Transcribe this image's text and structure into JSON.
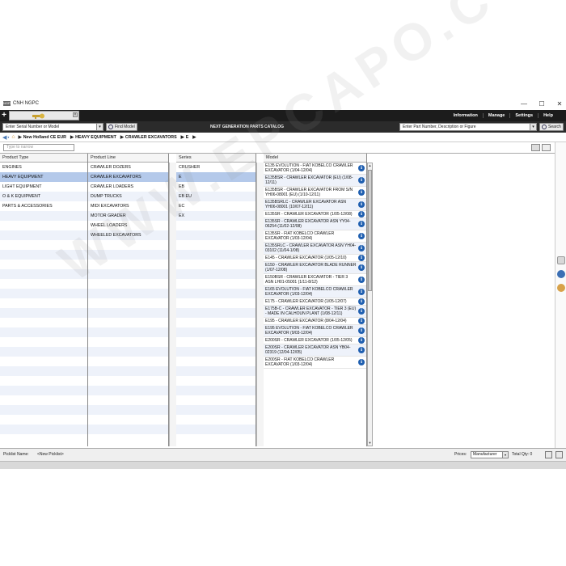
{
  "window": {
    "app_icon_text": "NGPC",
    "title": "CNH NGPC",
    "minimize": "—",
    "maximize": "☐",
    "close": "✕"
  },
  "menubar": {
    "new_tab": "+",
    "tab_close": "×",
    "items": [
      "Information",
      "Manage",
      "Settings",
      "Help"
    ]
  },
  "search": {
    "serial_placeholder": "Enter Serial Number or Model",
    "find_model": "Find Model",
    "catalog_title": "NEXT GENERATION PARTS CATALOG",
    "part_placeholder": "Enter Part Number, Description or Figure",
    "search_label": "Search"
  },
  "breadcrumb": [
    "New Holland CE EUR",
    "HEAVY EQUIPMENT",
    "CRAWLER EXCAVATORS",
    "E"
  ],
  "filter": {
    "placeholder": "Type to narrow"
  },
  "columns": {
    "product_type": {
      "header": "Product Type",
      "items": [
        "ENGINES",
        "HEAVY EQUIPMENT",
        "LIGHT EQUIPMENT",
        "O & K EQUIPMENT",
        "PARTS & ACCESSORIES"
      ],
      "selected": 1
    },
    "product_line": {
      "header": "Product Line",
      "items": [
        "CRAWLER DOZERS",
        "CRAWLER EXCAVATORS",
        "CRAWLER LOADERS",
        "DUMP TRUCKS",
        "MIDI EXCAVATORS",
        "MOTOR GRADER",
        "WHEEL LOADERS",
        "WHEELED EXCAVATORS"
      ],
      "selected": 1
    },
    "series": {
      "header": "Series",
      "items": [
        "CRUSHER",
        "E",
        "EB",
        "EB EU",
        "EC",
        "EX"
      ],
      "selected": 1
    },
    "model": {
      "header": "Model",
      "items": [
        "E135 EVOLUTION - FIAT KOBELCO CRAWLER EXCAVATOR (1/04-12/04)",
        "E135BSR - CRAWLER EXCAVATOR (EU) (1/08-12/11)",
        "E135BSR - CRAWLER EXCAVATOR FROM S/N YH06-08001 (EU) (1/10-12/11)",
        "E135BSRLC - CRAWLER EXCAVATOR ASN YH06-08001 (10/07-12/11)",
        "E135SR - CRAWLER EXCAVATOR (1/05-12/08)",
        "E135SR - CRAWLER EXCAVATOR ASN YY04-06254 (11/02-12/08)",
        "E135SR - FIAT KOBELCO CRAWLER EXCAVATOR (1/03-12/04)",
        "E135SRLC - CRAWLER EXCAVATOR ASN YH04-03102 (11/04-1/08)",
        "E145 - CRAWLER EXCAVATOR (1/05-12/10)",
        "E150 - CRAWLER EXCAVATOR BLADE RUNNER (1/07-12/08)",
        "E150BSR - CRAWLER EXCAVATOR - TIER 3 ASN LH01-05001 (1/11-8/12)",
        "E165 EVOLUTION - FIAT KOBELCO CRAWLER EXCAVATOR (1/03-12/04)",
        "E175 - CRAWLER EXCAVATOR (1/05-12/07)",
        "E175B-C - CRAWLER EXCAVATOR - TIER 3 (EU) - MADE IN CALHOUN PLANT (1/08-12/11)",
        "E195 - CRAWLER EXCAVATOR (8/04-12/04)",
        "E195 EVOLUTION - FIAT KOBELCO CRAWLER EXCAVATOR (9/03-12/04)",
        "E200SR - CRAWLER EXCAVATOR (1/05-12/05)",
        "E200SR - CRAWLER EXCAVATOR ASN YB04-02319 (12/04-12/05)",
        "E200SR - FIAT KOBELCO CRAWLER EXCAVATOR (1/03-12/04)"
      ],
      "info_icon": "i"
    }
  },
  "status": {
    "picklist_label": "Picklist Name:",
    "picklist_value": "<New Picklist>",
    "prices_label": "Prices:",
    "prices_value": "Manufacturer",
    "total_qty": "Total Qty: 0"
  },
  "watermark": "WWW.EPCAPO.COM",
  "colors": {
    "menubar": "#1c1c1c",
    "selected_row": "#b4c9ea",
    "alt_row": "#eef2fa",
    "info_icon": "#1f5fb0"
  }
}
